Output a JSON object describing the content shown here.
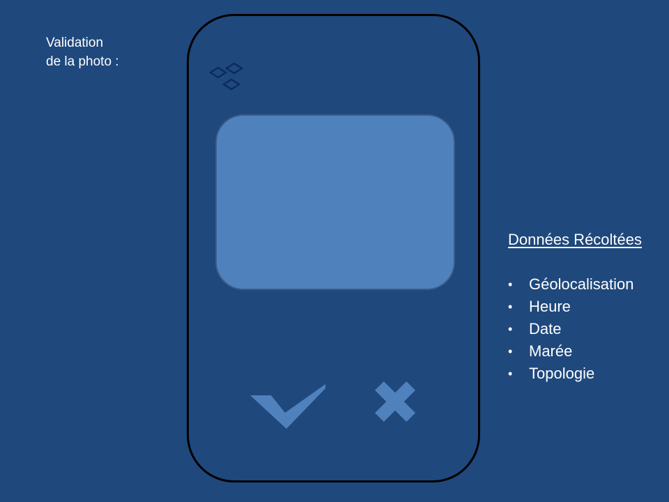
{
  "caption": {
    "line1": "Validation",
    "line2": "de la photo :"
  },
  "phone": {
    "logo_icon": "diamond-cluster-logo-icon",
    "photo_preview": "photo-preview",
    "validate_icon": "checkmark-icon",
    "reject_icon": "close-x-icon",
    "accent_color": "#4f81bd",
    "background_color": "#1f487c",
    "logo_color": "#0c2a63"
  },
  "data_panel": {
    "title": "Données Récoltées",
    "bullet": "•",
    "items": [
      "Géolocalisation",
      "Heure",
      "Date",
      "Marée",
      "Topologie"
    ]
  }
}
